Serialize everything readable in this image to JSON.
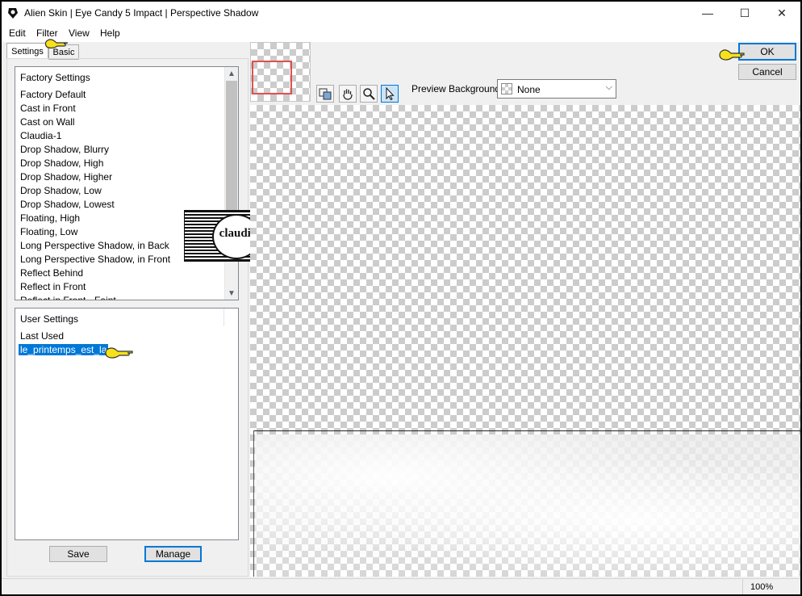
{
  "window": {
    "title": "Alien Skin | Eye Candy 5 Impact | Perspective Shadow",
    "minimize_glyph": "—",
    "maximize_glyph": "☐",
    "close_glyph": "✕"
  },
  "menu": [
    "Edit",
    "Filter",
    "View",
    "Help"
  ],
  "tabs": [
    "Settings",
    "Basic"
  ],
  "factory_settings": {
    "header": "Factory Settings",
    "items": [
      "Factory Default",
      "Cast in Front",
      "Cast on Wall",
      "Claudia-1",
      "Drop Shadow, Blurry",
      "Drop Shadow, High",
      "Drop Shadow, Higher",
      "Drop Shadow, Low",
      "Drop Shadow, Lowest",
      "Floating, High",
      "Floating, Low",
      "Long Perspective Shadow, in Back",
      "Long Perspective Shadow, in Front",
      "Reflect Behind",
      "Reflect in Front"
    ]
  },
  "user_settings": {
    "header": "User Settings",
    "items": [
      "Last Used",
      "le_printemps_est_la"
    ],
    "selected": "le_printemps_est_la"
  },
  "buttons": {
    "save": "Save",
    "manage": "Manage",
    "ok": "OK",
    "cancel": "Cancel"
  },
  "preview": {
    "background_label": "Preview Background:",
    "background_value": "None"
  },
  "watermark": {
    "text": "claudia"
  },
  "status": {
    "zoom": "100%"
  },
  "colors": {
    "accent": "#0078d7",
    "pointer_yellow": "#f7e11a",
    "nav_box_red": "#e05050"
  },
  "icons": [
    "app-icon",
    "navigate-icon",
    "hand-icon",
    "zoom-icon",
    "arrow-icon",
    "pointing-hand-icon"
  ]
}
